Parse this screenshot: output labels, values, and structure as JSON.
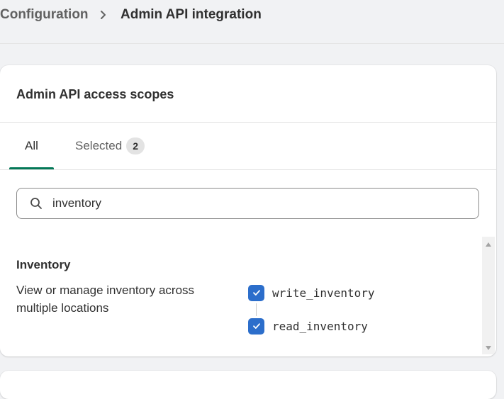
{
  "breadcrumb": {
    "parent": "Configuration",
    "current": "Admin API integration"
  },
  "scopes_card": {
    "title": "Admin API access scopes",
    "tabs": [
      {
        "label": "All",
        "active": true
      },
      {
        "label": "Selected",
        "badge": "2",
        "active": false
      }
    ],
    "search": {
      "value": "inventory",
      "icon": "search-icon"
    },
    "section": {
      "title": "Inventory",
      "description": "View or manage inventory across multiple locations",
      "scopes": [
        {
          "label": "write_inventory",
          "checked": true
        },
        {
          "label": "read_inventory",
          "checked": true
        }
      ]
    }
  },
  "colors": {
    "background": "#f1f2f4",
    "tab_underline": "#047857",
    "checkbox": "#2c6ecb"
  }
}
